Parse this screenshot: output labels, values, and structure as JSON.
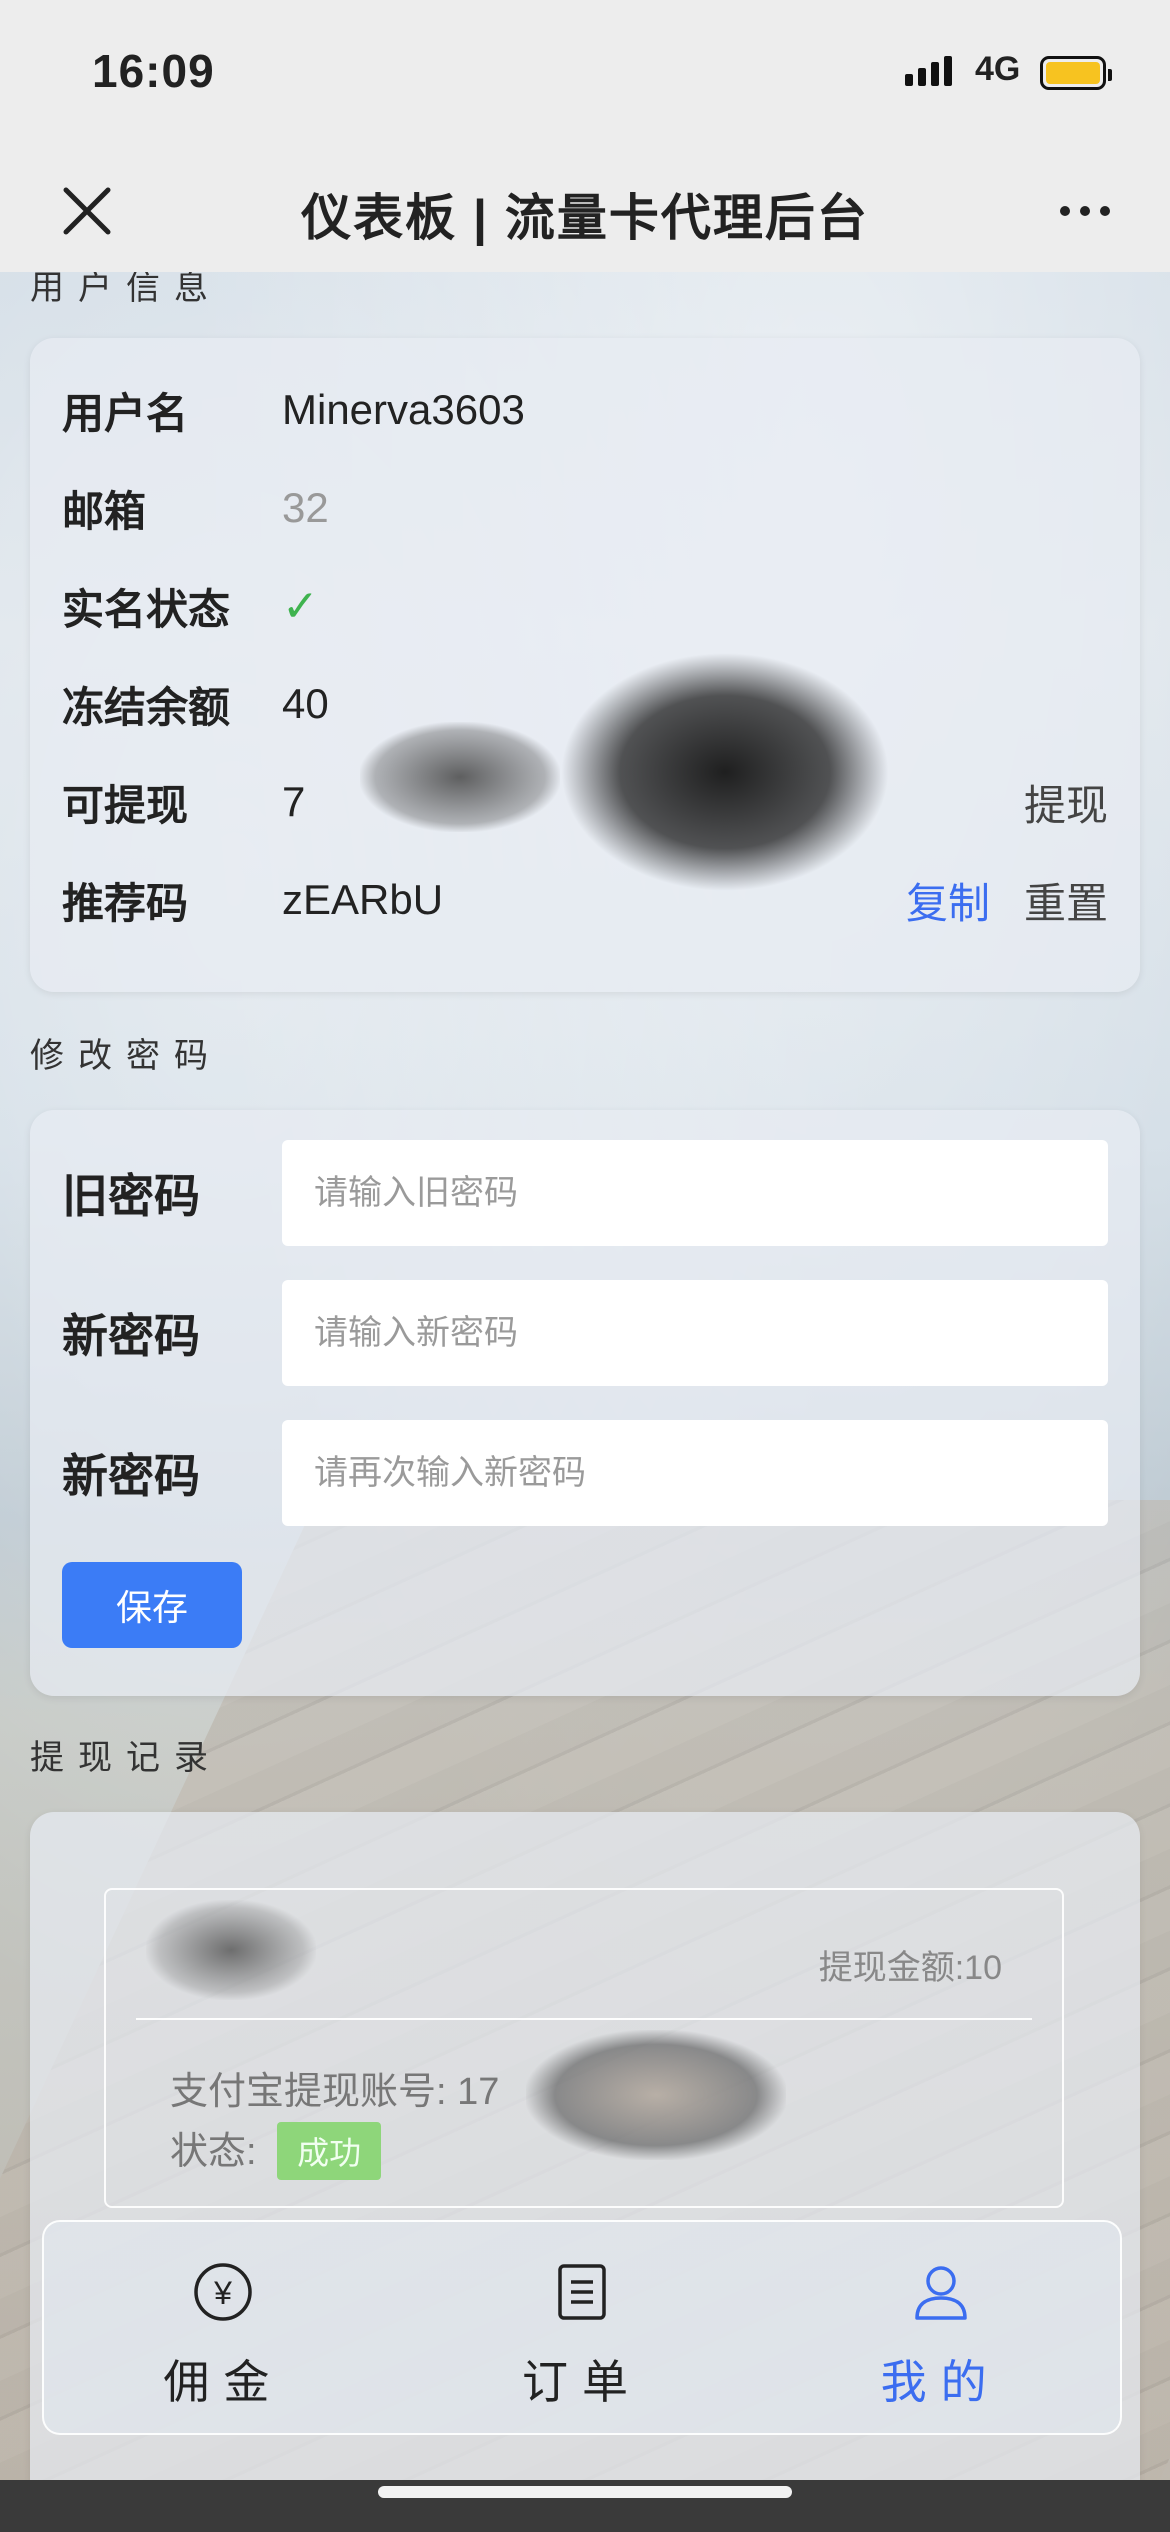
{
  "status_bar": {
    "time": "16:09",
    "network": "4G"
  },
  "title_bar": {
    "title": "仪表板 | 流量卡代理后台"
  },
  "user_info": {
    "section_title": "用户信息",
    "rows": [
      {
        "label": "用户名",
        "value": "Minerva3603"
      },
      {
        "label": "邮箱",
        "value": "32"
      },
      {
        "label": "实名状态",
        "value": "✓"
      },
      {
        "label": "冻结余额",
        "value": "40"
      },
      {
        "label": "可提现",
        "value": "7",
        "action": "提现"
      },
      {
        "label": "推荐码",
        "value": "zEARbU",
        "action_copy": "复制",
        "action_reset": "重置"
      }
    ]
  },
  "change_password": {
    "section_title": "修改密码",
    "fields": [
      {
        "label": "旧密码",
        "placeholder": "请输入旧密码"
      },
      {
        "label": "新密码",
        "placeholder": "请输入新密码"
      },
      {
        "label": "新密码",
        "placeholder": "请再次输入新密码"
      }
    ],
    "save_label": "保存"
  },
  "withdraw_records": {
    "section_title": "提现记录",
    "items": [
      {
        "amount": "提现金额:10",
        "account_label": "支付宝提现账号:",
        "account_value": "17",
        "status_label": "状态:",
        "status": "成功"
      }
    ]
  },
  "tabbar": {
    "tabs": [
      {
        "label": "佣金",
        "icon": "yen-circle-icon"
      },
      {
        "label": "订单",
        "icon": "order-list-icon"
      },
      {
        "label": "我的",
        "icon": "user-icon",
        "active": true
      }
    ]
  },
  "colors": {
    "accent": "#3b6df0",
    "button": "#3b7cf6",
    "success": "#8ed67a",
    "check": "#3fb34f"
  }
}
